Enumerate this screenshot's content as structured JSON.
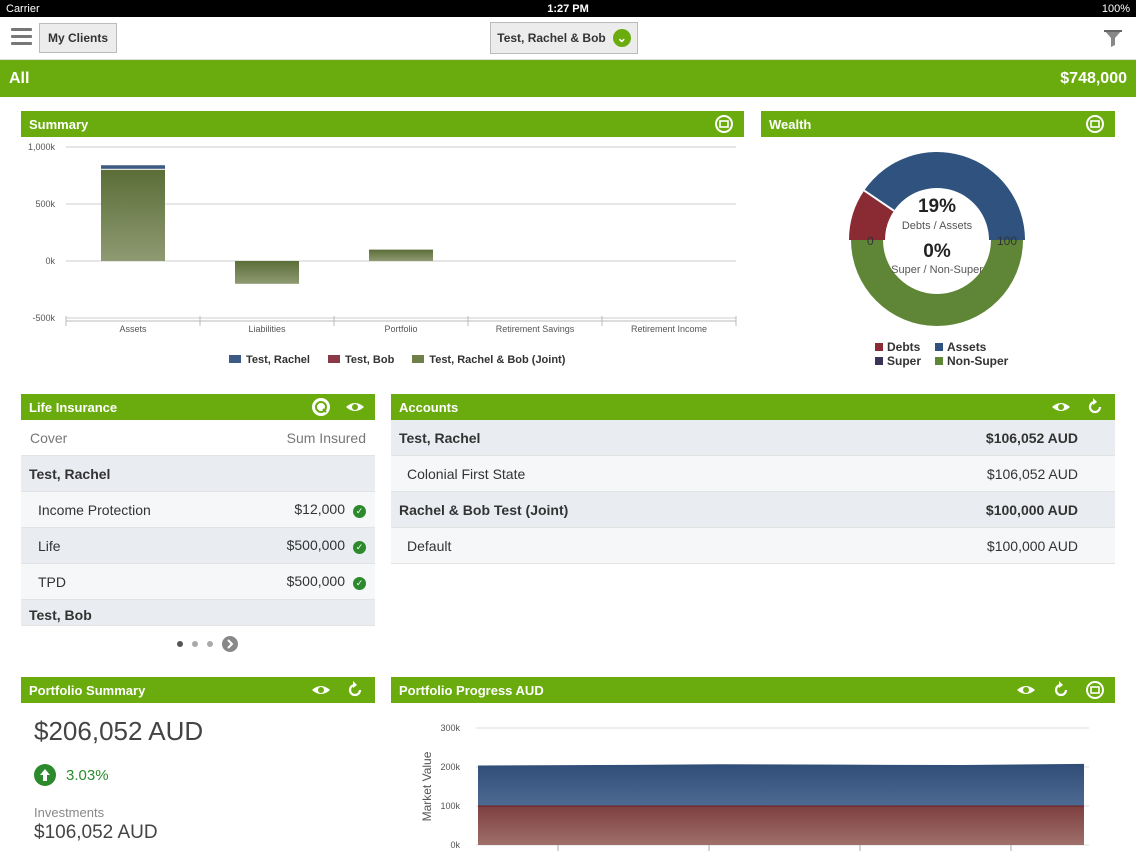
{
  "status": {
    "carrier": "Carrier",
    "time": "1:27 PM",
    "battery": "100%"
  },
  "topbar": {
    "my_clients": "My Clients",
    "client_selector": "Test, Rachel & Bob"
  },
  "filterbar": {
    "label": "All",
    "total": "$748,000"
  },
  "summary": {
    "title": "Summary",
    "chart_data": {
      "type": "bar",
      "categories": [
        "Assets",
        "Liabilities",
        "Portfolio",
        "Retirement Savings",
        "Retirement Income"
      ],
      "series": [
        {
          "name": "Test, Rachel",
          "values": [
            0,
            0,
            0,
            0,
            0
          ]
        },
        {
          "name": "Test, Bob",
          "values": [
            0,
            0,
            0,
            0,
            0
          ]
        },
        {
          "name": "Test, Rachel & Bob (Joint)",
          "values": [
            800,
            -200,
            100,
            0,
            0
          ]
        }
      ],
      "stack_top": {
        "category": "Assets",
        "series": "Test, Rachel",
        "value": 40
      },
      "yticks": [
        "1,000k",
        "500k",
        "0k",
        "-500k"
      ],
      "ylim": [
        -500,
        1000
      ],
      "colors": {
        "rachel": "#3d5a84",
        "bob": "#8a3a46",
        "joint": "#6e8048"
      }
    }
  },
  "wealth": {
    "title": "Wealth",
    "debts_assets_pct": "19%",
    "debts_assets_label": "Debts / Assets",
    "super_pct": "0%",
    "super_label": "Super / Non-Super",
    "scale_min": "0",
    "scale_max": "100",
    "debts_fraction": 0.19,
    "super_fraction": 0.0,
    "legend": {
      "debts": "Debts",
      "assets": "Assets",
      "super": "Super",
      "non_super": "Non-Super"
    },
    "colors": {
      "debts": "#8a2a32",
      "assets": "#2f527e",
      "super": "#3b3458",
      "non_super": "#5f8636"
    }
  },
  "life_insurance": {
    "title": "Life Insurance",
    "col_cover": "Cover",
    "col_sum": "Sum Insured",
    "rows": [
      {
        "label": "Test, Rachel",
        "type": "group"
      },
      {
        "label": "Income Protection",
        "value": "$12,000"
      },
      {
        "label": "Life",
        "value": "$500,000"
      },
      {
        "label": "TPD",
        "value": "$500,000"
      },
      {
        "label": "Test, Bob",
        "type": "group"
      }
    ]
  },
  "accounts": {
    "title": "Accounts",
    "rows": [
      {
        "label": "Test, Rachel",
        "value": "$106,052 AUD",
        "type": "group"
      },
      {
        "label": "Colonial First State",
        "value": "$106,052 AUD"
      },
      {
        "label": "Rachel & Bob Test (Joint)",
        "value": "$100,000 AUD",
        "type": "group"
      },
      {
        "label": "Default",
        "value": "$100,000 AUD"
      }
    ]
  },
  "portfolio_summary": {
    "title": "Portfolio Summary",
    "total": "$206,052 AUD",
    "growth": "3.03%",
    "investments_label": "Investments",
    "investments_value": "$106,052 AUD"
  },
  "portfolio_progress": {
    "title": "Portfolio Progress AUD",
    "chart_data": {
      "type": "area",
      "ylabel": "Market Value",
      "yticks": [
        "300k",
        "200k",
        "100k",
        "0k"
      ],
      "ylim": [
        0,
        300
      ],
      "series": [
        {
          "values": [
            100,
            100,
            100,
            100,
            100,
            100
          ]
        },
        {
          "values": [
            204,
            205,
            207,
            206,
            205,
            208
          ]
        }
      ],
      "colors": {
        "lower": "#8b4d4d",
        "upper": "#3a5a80"
      }
    }
  }
}
